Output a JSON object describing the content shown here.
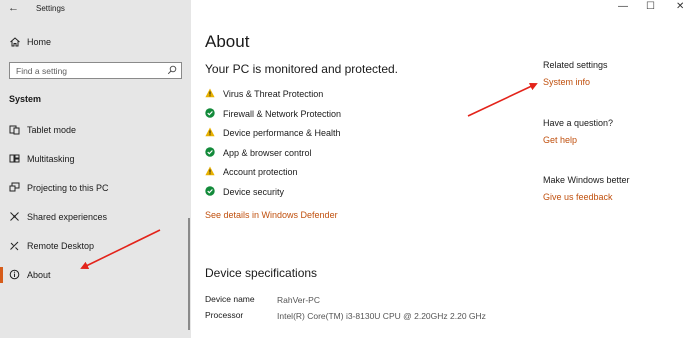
{
  "window": {
    "title": "Settings",
    "back_glyph": "←",
    "minimize_glyph": "—",
    "maximize_glyph": "☐",
    "close_glyph": "✕"
  },
  "sidebar": {
    "home_label": "Home",
    "search_placeholder": "Find a setting",
    "section_header": "System",
    "items": [
      {
        "label": "Tablet mode",
        "icon": "tablet-icon"
      },
      {
        "label": "Multitasking",
        "icon": "multitasking-icon"
      },
      {
        "label": "Projecting to this PC",
        "icon": "projecting-icon"
      },
      {
        "label": "Shared experiences",
        "icon": "shared-experiences-icon"
      },
      {
        "label": "Remote Desktop",
        "icon": "remote-desktop-icon"
      },
      {
        "label": "About",
        "icon": "info-icon",
        "active": true
      }
    ]
  },
  "main": {
    "title": "About",
    "subheading": "Your PC is monitored and protected.",
    "status_items": [
      {
        "label": "Virus & Threat Protection",
        "status": "warning"
      },
      {
        "label": "Firewall & Network Protection",
        "status": "ok"
      },
      {
        "label": "Device performance & Health",
        "status": "warning"
      },
      {
        "label": "App & browser control",
        "status": "ok"
      },
      {
        "label": "Account protection",
        "status": "warning"
      },
      {
        "label": "Device security",
        "status": "ok"
      }
    ],
    "defender_link": "See details in Windows Defender",
    "specs_header": "Device specifications",
    "specs": [
      {
        "key": "Device name",
        "value": "RahVer-PC"
      },
      {
        "key": "Processor",
        "value": "Intel(R) Core(TM) i3-8130U CPU @ 2.20GHz   2.20 GHz"
      }
    ]
  },
  "related": {
    "related_header": "Related settings",
    "system_info_link": "System info",
    "question_header": "Have a question?",
    "get_help_link": "Get help",
    "better_header": "Make Windows better",
    "feedback_link": "Give us feedback"
  },
  "colors": {
    "accent": "#c0500e",
    "active_bar": "#d65c1a",
    "warning": "#e8b100",
    "ok": "#128a3a",
    "arrow": "#e3231a"
  }
}
